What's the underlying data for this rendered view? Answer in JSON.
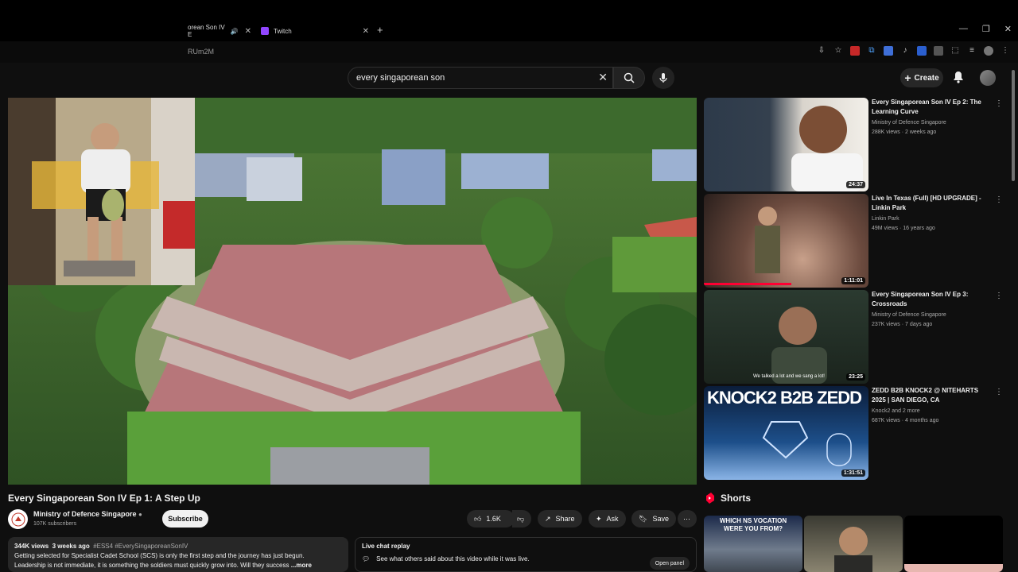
{
  "browser": {
    "tabs": [
      {
        "label": "orean Son IV E"
      },
      {
        "label": "Twitch"
      }
    ],
    "url_fragment": "RUm2M"
  },
  "search": {
    "query": "every singaporean son"
  },
  "masthead": {
    "create_label": "Create"
  },
  "video": {
    "title": "Every Singaporean Son IV Ep 1: A Step Up",
    "channel": "Ministry of Defence Singapore",
    "subscribers": "107K subscribers",
    "subscribe_label": "Subscribe",
    "likes": "1.6K",
    "share_label": "Share",
    "ask_label": "Ask",
    "save_label": "Save",
    "views": "344K views",
    "age": "3 weeks ago",
    "tags": "#ESS4 #EverySingaporeanSonIV",
    "description_line1": "Getting selected for Specialist Cadet School (SCS) is only the first step and the journey has just begun.",
    "description_line2": "Leadership is not immediate, it is something the soldiers must quickly grow into. Will they success",
    "more_label": "...more"
  },
  "chat": {
    "title": "Live chat replay",
    "text": "See what others said about this video while it was live.",
    "open_label": "Open panel"
  },
  "recommendations": [
    {
      "title": "Every Singaporean Son IV Ep 2: The Learning Curve",
      "channel": "Ministry of Defence Singapore",
      "meta": "288K views · 2 weeks ago",
      "duration": "24:37",
      "thumb_text": ""
    },
    {
      "title": "Live In Texas (Full) [HD UPGRADE] - Linkin Park",
      "channel": "Linkin Park",
      "meta": "49M views · 16 years ago",
      "duration": "1:11:01",
      "thumb_text": ""
    },
    {
      "title": "Every Singaporean Son IV Ep 3: Crossroads",
      "channel": "Ministry of Defence Singapore",
      "meta": "237K views · 7 days ago",
      "duration": "23:25",
      "thumb_text": "We talked a lot and we sang a lot!"
    },
    {
      "title": "ZEDD B2B KNOCK2 @ NITEHARTS 2025 | SAN DIEGO, CA",
      "channel": "Knock2 and 2 more",
      "meta": "687K views · 4 months ago",
      "duration": "1:31:51",
      "thumb_text": "KNOCK2 B2B ZEDD"
    }
  ],
  "shorts": {
    "title": "Shorts",
    "items": [
      {
        "caption": "WHICH NS VOCATION WERE YOU FROM?"
      }
    ]
  },
  "colors": {
    "brand_red": "#ff0033",
    "bg": "#0f0f0f"
  }
}
